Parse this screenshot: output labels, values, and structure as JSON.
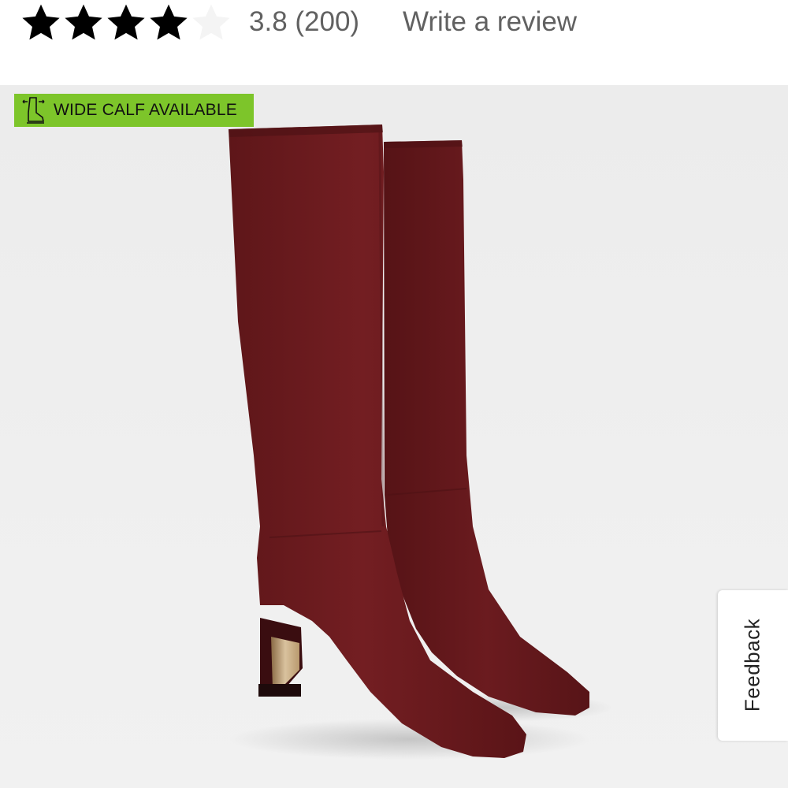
{
  "rating": {
    "value": 3.8,
    "max": 5,
    "filled_stars": 4,
    "summary_text": "3.8 (200)",
    "write_review_label": "Write a review",
    "colors": {
      "star_filled": "#000000",
      "star_empty": "#f4f4f4",
      "text": "#616161"
    }
  },
  "product": {
    "badge": {
      "label": "WIDE CALF AVAILABLE",
      "icon": "boot-icon",
      "color": "#7dc52a"
    },
    "boot_color": "#6e1c20",
    "image_background": "#ededed"
  },
  "feedback": {
    "label": "Feedback"
  }
}
